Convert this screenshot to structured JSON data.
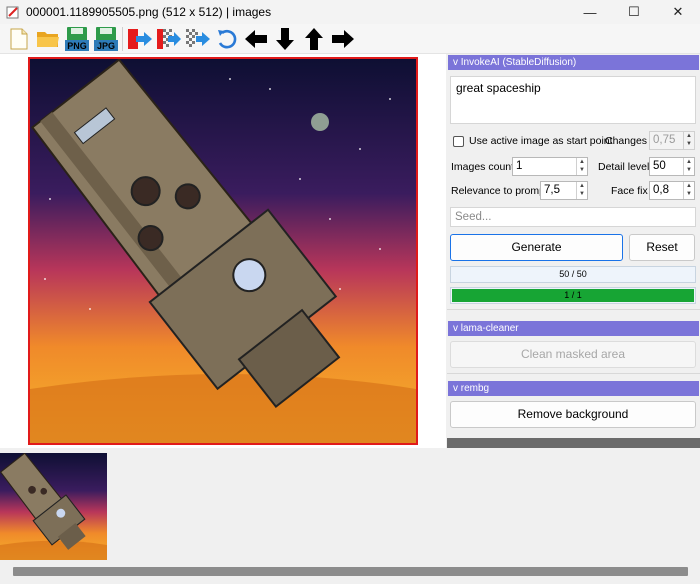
{
  "window": {
    "title": "000001.1189905505.png (512 x 512) | images",
    "minimize_glyph": "—",
    "maximize_glyph": "☐",
    "close_glyph": "✕"
  },
  "toolbar": {
    "png_label": "PNG",
    "jpg_label": "JPG",
    "icons": [
      "new-file-icon",
      "open-folder-icon",
      "save-png-icon",
      "save-jpg-icon",
      "red-to-arrow-icon",
      "checker-to-arrow-icon",
      "undo-icon",
      "arrow-left-icon",
      "arrow-down-icon",
      "arrow-up-icon",
      "arrow-right-icon"
    ]
  },
  "invoke": {
    "header": "v InvokeAI (StableDiffusion)",
    "prompt": "great spaceship",
    "use_active_label": "Use active image as start point",
    "use_active_checked": false,
    "changes_label": "Changes",
    "changes_value": "0,75",
    "images_count_label": "Images count",
    "images_count_value": "1",
    "detail_level_label": "Detail level",
    "detail_level_value": "50",
    "relevance_label": "Relevance to prompt",
    "relevance_value": "7,5",
    "face_fix_label": "Face fix",
    "face_fix_value": "0,8",
    "seed_placeholder": "Seed...",
    "generate_label": "Generate",
    "reset_label": "Reset",
    "steps_text": "50 / 50",
    "steps_progress": 1.0,
    "images_text": "1 / 1",
    "images_progress": 1.0
  },
  "lama": {
    "header": "v lama-cleaner",
    "clean_label": "Clean masked area"
  },
  "rembg": {
    "header": "v rembg",
    "remove_label": "Remove background"
  },
  "colors": {
    "section_header": "#7b74d9",
    "progress_green": "#17a534",
    "selection_border": "#e11a1a"
  }
}
